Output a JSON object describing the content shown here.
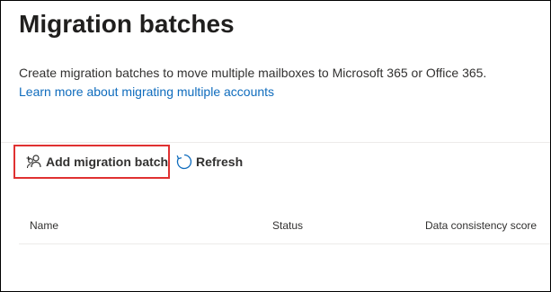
{
  "page": {
    "title": "Migration batches",
    "description": "Create migration batches to move multiple mailboxes to Microsoft 365 or Office 365.",
    "learn_more_link": "Learn more about migrating multiple accounts"
  },
  "toolbar": {
    "add_label": "Add migration batch",
    "add_icon": "add-people-icon",
    "refresh_label": "Refresh",
    "refresh_icon": "refresh-icon"
  },
  "table": {
    "columns": [
      "Name",
      "Status",
      "Data consistency score"
    ],
    "rows": []
  },
  "colors": {
    "link": "#0f6cbd",
    "highlight_border": "#e03131",
    "text": "#323130"
  }
}
